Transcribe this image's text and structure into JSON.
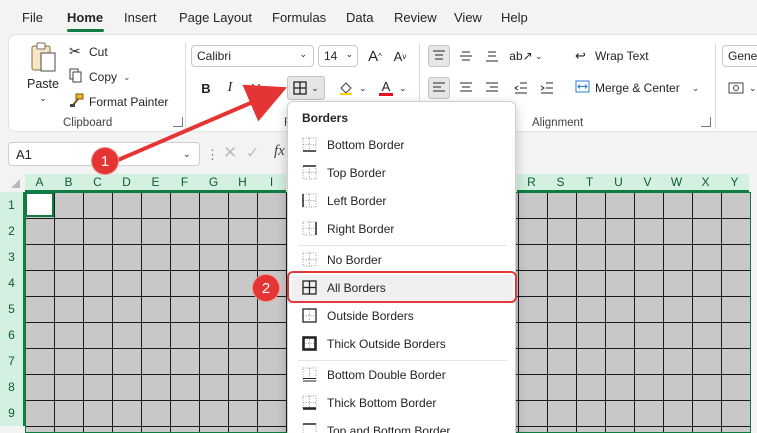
{
  "menu_bar": {
    "tabs": [
      "File",
      "Home",
      "Insert",
      "Page Layout",
      "Formulas",
      "Data",
      "Review",
      "View",
      "Help"
    ],
    "active_tab": "Home"
  },
  "ribbon": {
    "clipboard": {
      "paste_label": "Paste",
      "cut_label": "Cut",
      "copy_label": "Copy",
      "format_painter_label": "Format Painter",
      "group_label": "Clipboard"
    },
    "font": {
      "font_name": "Calibri",
      "font_size": "14",
      "bold": "B",
      "italic": "I",
      "underline": "U",
      "group_label_partial": "F"
    },
    "alignment": {
      "wrap_text_label": "Wrap Text",
      "merge_center_label": "Merge & Center",
      "group_label": "Alignment"
    },
    "number": {
      "format_value": "Genera"
    }
  },
  "formula_bar": {
    "name_box": "A1",
    "fx_label": "fx"
  },
  "grid": {
    "columns_left": [
      "A",
      "B",
      "C",
      "D",
      "E",
      "F",
      "G",
      "H",
      "I"
    ],
    "columns_right": [
      "R",
      "S",
      "T",
      "U",
      "V",
      "W",
      "X",
      "Y"
    ],
    "rows": [
      "1",
      "2",
      "3",
      "4",
      "5",
      "6",
      "7",
      "8",
      "9"
    ]
  },
  "borders_menu": {
    "title": "Borders",
    "items": [
      {
        "label": "Bottom Border",
        "icon": "bottom-border-icon"
      },
      {
        "label": "Top Border",
        "icon": "top-border-icon"
      },
      {
        "label": "Left Border",
        "icon": "left-border-icon"
      },
      {
        "label": "Right Border",
        "icon": "right-border-icon"
      },
      {
        "label": "No Border",
        "icon": "no-border-icon"
      },
      {
        "label": "All Borders",
        "icon": "all-borders-icon"
      },
      {
        "label": "Outside Borders",
        "icon": "outside-borders-icon"
      },
      {
        "label": "Thick Outside Borders",
        "icon": "thick-outside-borders-icon"
      },
      {
        "label": "Bottom Double Border",
        "icon": "bottom-double-border-icon"
      },
      {
        "label": "Thick Bottom Border",
        "icon": "thick-bottom-border-icon"
      },
      {
        "label": "Top and Bottom Border",
        "icon": "top-bottom-border-icon"
      }
    ],
    "highlighted_item": "All Borders"
  },
  "annotations": {
    "step1": "1",
    "step2": "2"
  },
  "colors": {
    "excel_green": "#107c41",
    "annotation_red": "#e53434",
    "selection_fill": "#c8c8c8"
  }
}
